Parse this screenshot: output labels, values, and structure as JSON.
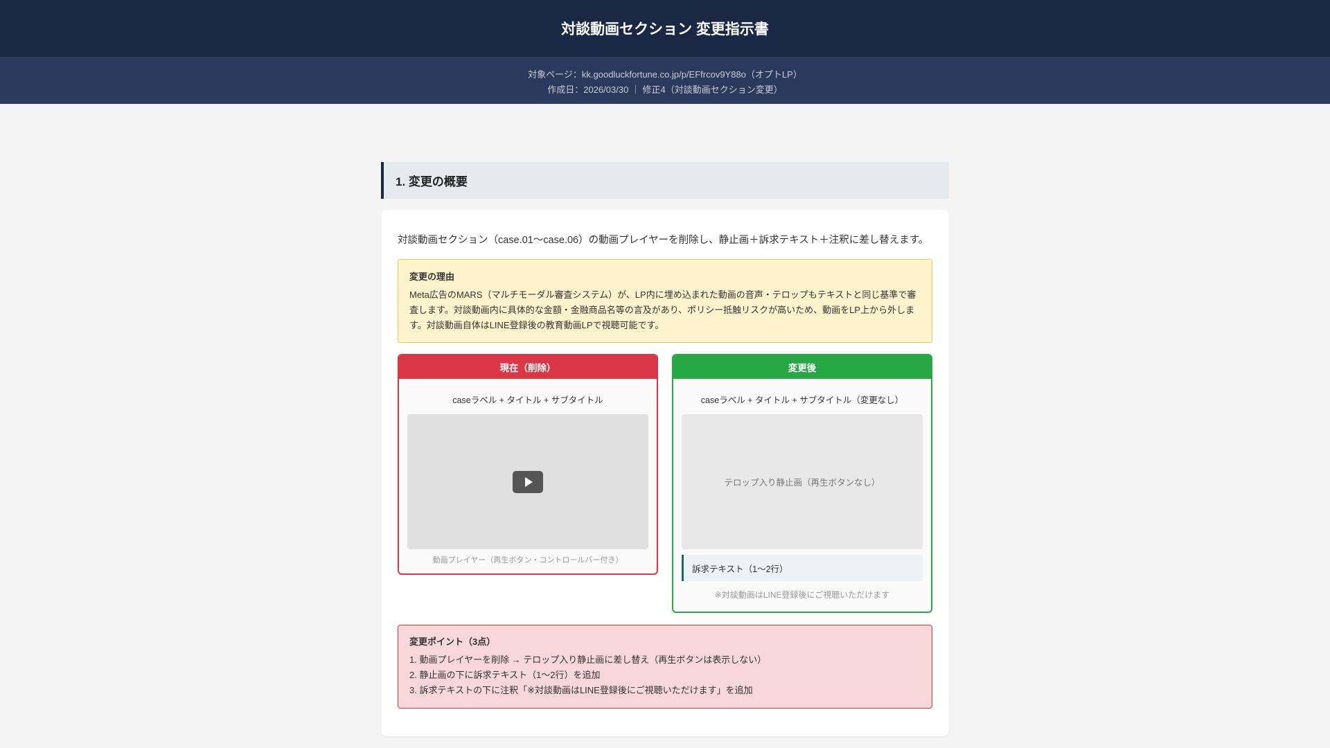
{
  "header": {
    "title": "対談動画セクション 変更指示書",
    "target_page": "対象ページ：kk.goodluckfortune.co.jp/p/EFfrcov9Y88o（オプトLP）",
    "meta": "作成日：2026/03/30 ｜ 修正4（対談動画セクション変更）"
  },
  "section": {
    "title": "1. 変更の概要",
    "intro": "対談動画セクション（case.01〜case.06）の動画プレイヤーを削除し、静止画＋訴求テキスト＋注釈に差し替えます。",
    "reason": {
      "title": "変更の理由",
      "body": "Meta広告のMARS（マルチモーダル審査システム）が、LP内に埋め込まれた動画の音声・テロップもテキストと同じ基準で審査します。対談動画内に具体的な金額・金融商品名等の言及があり、ポリシー抵触リスクが高いため、動画をLP上から外します。対談動画自体はLINE登録後の教育動画LPで視聴可能です。"
    },
    "before": {
      "header": "現在（削除）",
      "label": "caseラベル + タイトル + サブタイトル",
      "caption": "動画プレイヤー（再生ボタン・コントロールバー付き）"
    },
    "after": {
      "header": "変更後",
      "label": "caseラベル + タイトル + サブタイトル（変更なし）",
      "image": "テロップ入り静止画（再生ボタンなし）",
      "appeal": "訴求テキスト（1〜2行）",
      "note": "※対談動画はLINE登録後にご視聴いただけます"
    },
    "points": {
      "title": "変更ポイント（3点）",
      "items": [
        "1. 動画プレイヤーを削除 → テロップ入り静止画に差し替え（再生ボタンは表示しない）",
        "2. 静止画の下に訴求テキスト（1〜2行）を追加",
        "3. 訴求テキストの下に注釈「※対談動画はLINE登録後にご視聴いただけます」を追加"
      ]
    }
  }
}
